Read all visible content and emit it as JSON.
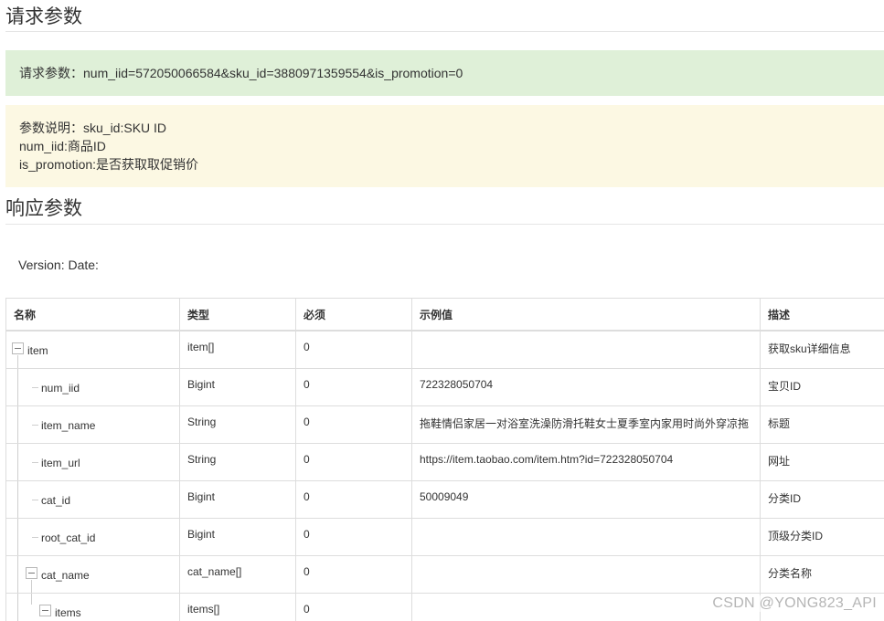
{
  "request_section": {
    "title": "请求参数",
    "params_line": "请求参数：num_iid=572050066584&sku_id=3880971359554&is_promotion=0",
    "notes": [
      "参数说明：sku_id:SKU ID",
      "num_iid:商品ID",
      "is_promotion:是否获取取促销价"
    ]
  },
  "response_section": {
    "title": "响应参数",
    "version_line": "Version: Date:"
  },
  "table": {
    "headers": [
      "名称",
      "类型",
      "必须",
      "示例值",
      "描述"
    ],
    "rows": [
      {
        "name": "item",
        "type": "item[]",
        "required": "0",
        "example": "",
        "desc": "获取sku详细信息"
      },
      {
        "name": "num_iid",
        "type": "Bigint",
        "required": "0",
        "example": "722328050704",
        "desc": "宝贝ID"
      },
      {
        "name": "item_name",
        "type": "String",
        "required": "0",
        "example": "拖鞋情侣家居一对浴室洗澡防滑托鞋女士夏季室内家用时尚外穿凉拖",
        "desc": "标题"
      },
      {
        "name": "item_url",
        "type": "String",
        "required": "0",
        "example": "https://item.taobao.com/item.htm?id=722328050704",
        "desc": "网址"
      },
      {
        "name": "cat_id",
        "type": "Bigint",
        "required": "0",
        "example": "50009049",
        "desc": "分类ID"
      },
      {
        "name": "root_cat_id",
        "type": "Bigint",
        "required": "0",
        "example": "",
        "desc": "顶级分类ID"
      },
      {
        "name": "cat_name",
        "type": "cat_name[]",
        "required": "0",
        "example": "",
        "desc": "分类名称"
      },
      {
        "name": "items",
        "type": "items[]",
        "required": "0",
        "example": "",
        "desc": ""
      }
    ]
  },
  "watermark": "CSDN @YONG823_API",
  "colors": {
    "success_bg": "#dff0d8",
    "warning_bg": "#fcf8e3",
    "border": "#dddddd"
  }
}
